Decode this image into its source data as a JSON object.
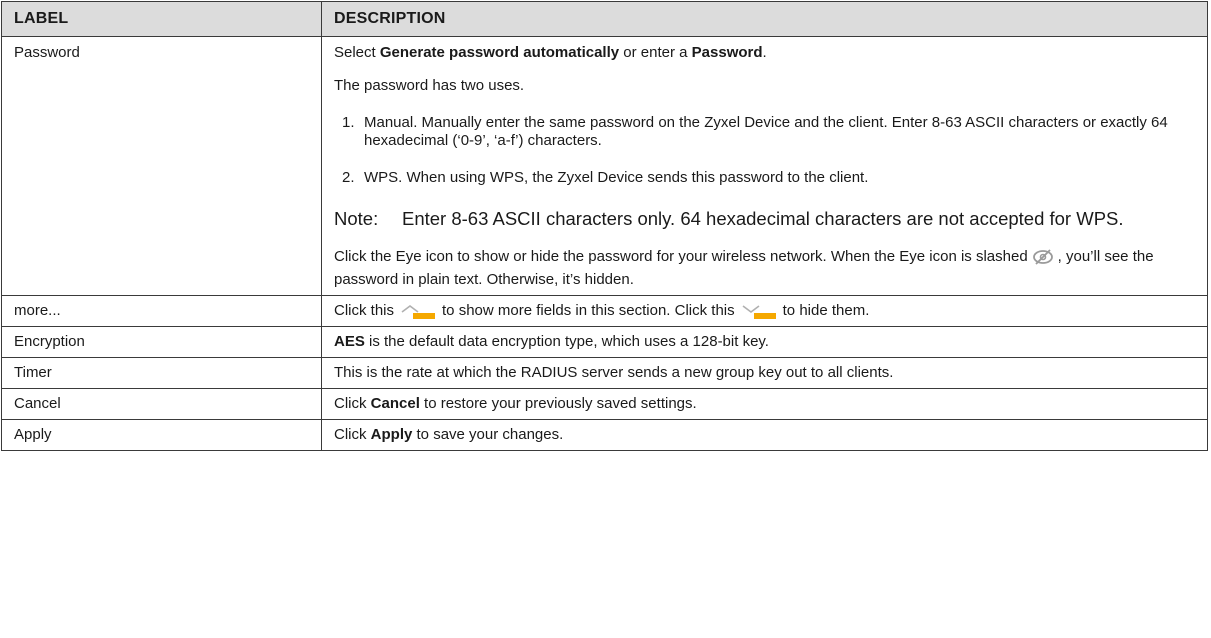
{
  "headers": {
    "label": "LABEL",
    "description": "DESCRIPTION"
  },
  "rows": {
    "password": {
      "label": "Password",
      "line1": {
        "pre": "Select ",
        "b1": "Generate password automatically",
        "mid": " or enter a ",
        "b2": "Password",
        "post": "."
      },
      "line2": "The password has two uses.",
      "item1": {
        "num": "1.",
        "text": "Manual. Manually enter the same password on the Zyxel Device and the client. Enter 8-63 ASCII characters or exactly 64 hexadecimal (‘0-9’, ‘a-f’) characters."
      },
      "item2": {
        "num": "2.",
        "text": "WPS. When using WPS, the Zyxel Device sends this password to the client."
      },
      "note": {
        "label": "Note:",
        "text": "Enter 8-63 ASCII characters only. 64 hexadecimal characters are not accepted for WPS."
      },
      "eye": {
        "pre": "Click the Eye icon to show or hide the password for your wireless network. When the Eye icon is slashed",
        "post": ", you’ll see the password in plain text. Otherwise, it’s hidden.",
        "icon": "eye-slashed-icon"
      }
    },
    "more": {
      "label": "more...",
      "pre": "Click this",
      "mid": "to show more fields in this section. Click this",
      "post": "to hide them.",
      "icon_up": "chevron-up-icon",
      "icon_down": "chevron-down-icon",
      "accent": "#f5a800"
    },
    "encryption": {
      "label": "Encryption",
      "bold": "AES",
      "text": " is the default data encryption type, which uses a 128-bit key."
    },
    "timer": {
      "label": "Timer",
      "text": "This is the rate at which the RADIUS server sends a new group key out to all clients."
    },
    "cancel": {
      "label": "Cancel",
      "pre": "Click ",
      "bold": "Cancel",
      "post": " to restore your previously saved settings."
    },
    "apply": {
      "label": "Apply",
      "pre": "Click ",
      "bold": "Apply",
      "post": " to save your changes."
    }
  }
}
